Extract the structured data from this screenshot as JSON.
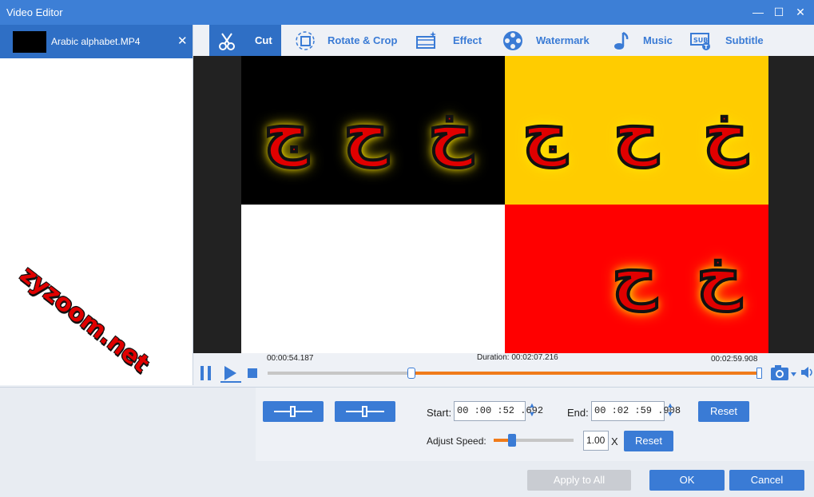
{
  "window": {
    "title": "Video Editor",
    "minimize": "—",
    "maximize": "☐",
    "close": "✕"
  },
  "file": {
    "name": "Arabic alphabet.MP4",
    "close": "✕"
  },
  "watermark": "zyzoom.net",
  "tabs": [
    {
      "label": "Cut",
      "icon": "scissors-icon"
    },
    {
      "label": "Rotate & Crop",
      "icon": "crop-rotate-icon"
    },
    {
      "label": "Effect",
      "icon": "film-sparkle-icon"
    },
    {
      "label": "Watermark",
      "icon": "film-reel-icon"
    },
    {
      "label": "Music",
      "icon": "music-note-icon"
    },
    {
      "label": "Subtitle",
      "icon": "subtitle-icon"
    }
  ],
  "video": {
    "letters_top_left": [
      "ج",
      "ح",
      "خ"
    ],
    "letters_top_right": [
      "ج",
      "ح",
      "خ"
    ],
    "letters_bottom_right": [
      "ح",
      "خ"
    ],
    "colors": {
      "black": "#000000",
      "yellow": "#ffcc00",
      "white": "#ffffff",
      "red": "#ff0000"
    }
  },
  "playback": {
    "current_time": "00:00:54.187",
    "duration": "Duration: 00:02:07.216",
    "end_time": "00:02:59.908",
    "progress_fraction": 0.292,
    "accent": "#f07b1a"
  },
  "cut": {
    "start_label": "Start:",
    "start_value": "00 :00 :52 .692",
    "end_label": "End:",
    "end_value": "00 :02 :59 .908",
    "reset_label": "Reset",
    "speed_label": "Adjust Speed:",
    "speed_value": "1.00",
    "speed_unit": "X",
    "speed_reset_label": "Reset"
  },
  "footer": {
    "apply_all": "Apply to All",
    "ok": "OK",
    "cancel": "Cancel"
  },
  "brand_color": "#3a7bd5"
}
